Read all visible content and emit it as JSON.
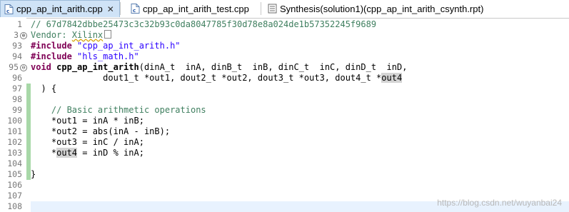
{
  "tabs": [
    {
      "label": "cpp_ap_int_arith.cpp",
      "active": true,
      "close": "✕",
      "icon": "c-source-file-icon"
    },
    {
      "label": "cpp_ap_int_arith_test.cpp",
      "active": false,
      "icon": "c-source-file-icon"
    },
    {
      "label": "Synthesis(solution1)(cpp_ap_int_arith_csynth.rpt)",
      "active": false,
      "icon": "report-file-icon"
    }
  ],
  "colors": {
    "active_tab": "#cfe3f7",
    "keyword": "#7f0055",
    "string": "#2a00ff",
    "comment": "#3f7f5f",
    "line_number": "#787878",
    "change_bar": "#a8d8a8",
    "current_line": "#e8f2fe"
  },
  "editor": {
    "lines": [
      {
        "num": "1",
        "text": "// 67d7842dbbe25473c3c32b93c0da8047785f30d78e8a024de1b57352245f9689"
      },
      {
        "num": "3",
        "fold": "⊕",
        "text_a": "Vendor: ",
        "text_b": "Xilinx"
      },
      {
        "num": "93",
        "kw": "#include",
        "str": "\"cpp_ap_int_arith.h\""
      },
      {
        "num": "94",
        "kw": "#include",
        "str": "\"hls_math.h\""
      },
      {
        "num": "95",
        "fold": "⊖",
        "kw": "void",
        "fn": "cpp_ap_int_arith",
        "rest": "(dinA_t  inA, dinB_t  inB, dinC_t  inC, dinD_t  inD,"
      },
      {
        "num": "96",
        "pre": "              dout1_t *out1, dout2_t *out2, dout3_t *out3, dout4_t *",
        "hl": "out4"
      },
      {
        "num": "97",
        "text": "  ) {"
      },
      {
        "num": "98",
        "text": ""
      },
      {
        "num": "99",
        "text": "    // Basic arithmetic operations"
      },
      {
        "num": "100",
        "text": "    *out1 = inA * inB;"
      },
      {
        "num": "101",
        "text": "    *out2 = abs(inA - inB);"
      },
      {
        "num": "102",
        "text": "    *out3 = inC / inA;"
      },
      {
        "num": "103",
        "pre": "    *",
        "hl": "out4",
        "post": " = inD % inA;"
      },
      {
        "num": "104",
        "text": ""
      },
      {
        "num": "105",
        "text": "}"
      },
      {
        "num": "106",
        "text": ""
      },
      {
        "num": "107",
        "text": ""
      },
      {
        "num": "108",
        "text": ""
      }
    ]
  },
  "watermark": "https://blog.csdn.net/wuyanbai24"
}
